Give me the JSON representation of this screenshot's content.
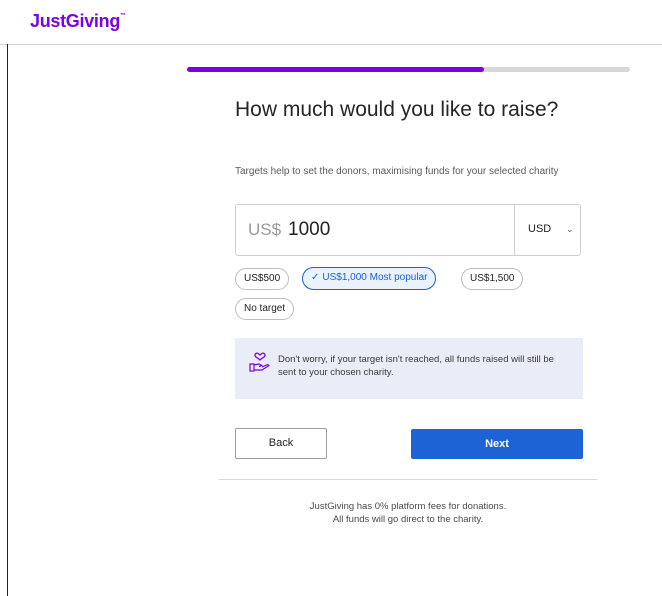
{
  "header": {
    "logo_text": "JustGiving",
    "logo_mark": "™"
  },
  "progress": {
    "fraction": 0.67,
    "fill_color": "#7a04dd"
  },
  "page": {
    "title": "How much would you like to raise?",
    "subtitle": "Targets help to set the donors, maximising funds for your selected charity"
  },
  "amount": {
    "currency_prefix": "US$",
    "value": "1000",
    "currency": "USD"
  },
  "presets": [
    {
      "label": "US$500",
      "selected": false
    },
    {
      "label": "US$1,000  Most popular",
      "selected": true
    },
    {
      "label": "US$1,500",
      "selected": false
    },
    {
      "label": "No target",
      "selected": false
    }
  ],
  "info": {
    "icon": "heart-hand-icon",
    "text": "Don't worry, if your target isn't reached, all funds raised will still be sent to your chosen charity."
  },
  "actions": {
    "back_label": "Back",
    "next_label": "Next"
  },
  "footer": {
    "line1": "JustGiving has 0% platform fees for donations.",
    "line2": "All funds will go direct to the charity."
  },
  "colors": {
    "brand": "#7a04dd",
    "primary": "#1e63d6",
    "info_bg": "#e8edf7"
  }
}
